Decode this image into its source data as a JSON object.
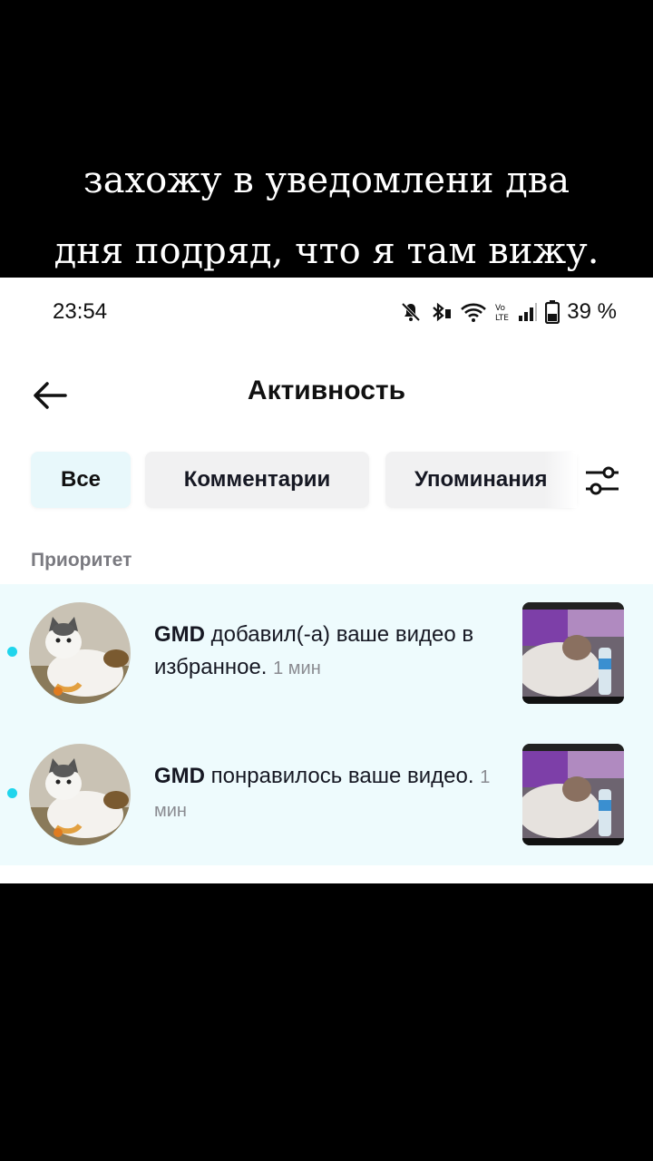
{
  "caption": {
    "line1": "захожу в уведомлени два",
    "line2": "дня подряд, что я там вижу."
  },
  "status_bar": {
    "time": "23:54",
    "battery": "39 %",
    "icons": [
      "mute-bell-icon",
      "bluetooth-icon",
      "wifi-icon",
      "volte-icon",
      "signal-icon",
      "battery-icon"
    ],
    "volte_label": "Vo LTE"
  },
  "header": {
    "title": "Активность",
    "back_icon": "back-arrow-icon"
  },
  "tabs": [
    {
      "label": "Все",
      "active": true
    },
    {
      "label": "Комментарии",
      "active": false
    },
    {
      "label": "Упоминания",
      "active": false
    }
  ],
  "filter_icon": "filter-sliders-icon",
  "section_title": "Приоритет",
  "notifications": [
    {
      "user": "GMD",
      "action": " добавил(-а) ваше видео в избранное.",
      "time": "1 мин",
      "unread": true
    },
    {
      "user": "GMD",
      "action": " понравилось ваше видео.",
      "time": "1 мин",
      "unread": true
    }
  ],
  "colors": {
    "accent_dot": "#20d5ec",
    "active_tab_bg": "#e8f8fb",
    "list_bg": "#eefbfd"
  }
}
